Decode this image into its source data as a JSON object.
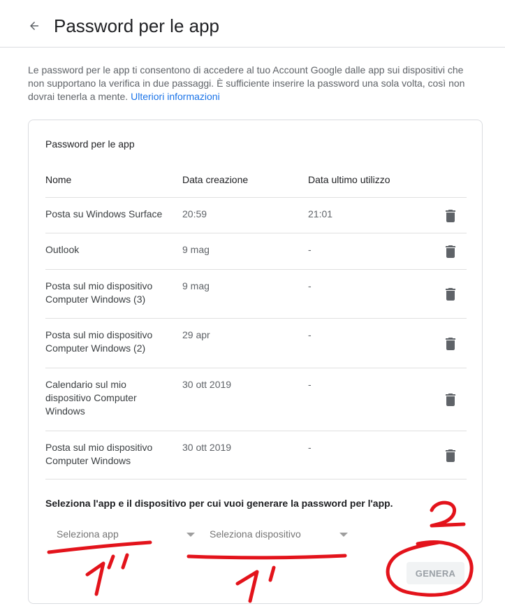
{
  "header": {
    "title": "Password per le app"
  },
  "intro": {
    "text": "Le password per le app ti consentono di accedere al tuo Account Google dalle app sui dispositivi che non supportano la verifica in due passaggi. È sufficiente inserire la password una sola volta, così non dovrai tenerla a mente.",
    "link": "Ulteriori informazioni"
  },
  "card": {
    "title": "Password per le app",
    "columns": {
      "name": "Nome",
      "created": "Data creazione",
      "last_used": "Data ultimo utilizzo"
    },
    "rows": [
      {
        "name": "Posta su Windows Surface",
        "created": "20:59",
        "last_used": "21:01"
      },
      {
        "name": "Outlook",
        "created": "9 mag",
        "last_used": "-"
      },
      {
        "name": "Posta sul mio dispositivo Computer Windows (3)",
        "created": "9 mag",
        "last_used": "-"
      },
      {
        "name": "Posta sul mio dispositivo Computer Windows (2)",
        "created": "29 apr",
        "last_used": "-"
      },
      {
        "name": "Calendario sul mio dispositivo Computer Windows",
        "created": "30 ott 2019",
        "last_used": "-"
      },
      {
        "name": "Posta sul mio dispositivo Computer Windows",
        "created": "30 ott 2019",
        "last_used": "-"
      }
    ],
    "row_icon": "trash-icon",
    "generate": {
      "label": "Seleziona l'app e il dispositivo per cui vuoi generare la password per l'app.",
      "app_select": "Seleziona app",
      "device_select": "Seleziona dispositivo",
      "button": "GENERA"
    }
  },
  "annotations": {
    "color": "#e3131b",
    "step_app": "1\"",
    "step_device": "1'",
    "step_generate": "2"
  },
  "colors": {
    "link": "#1a73e8",
    "border": "#dadce0",
    "icon": "#5f6368"
  }
}
